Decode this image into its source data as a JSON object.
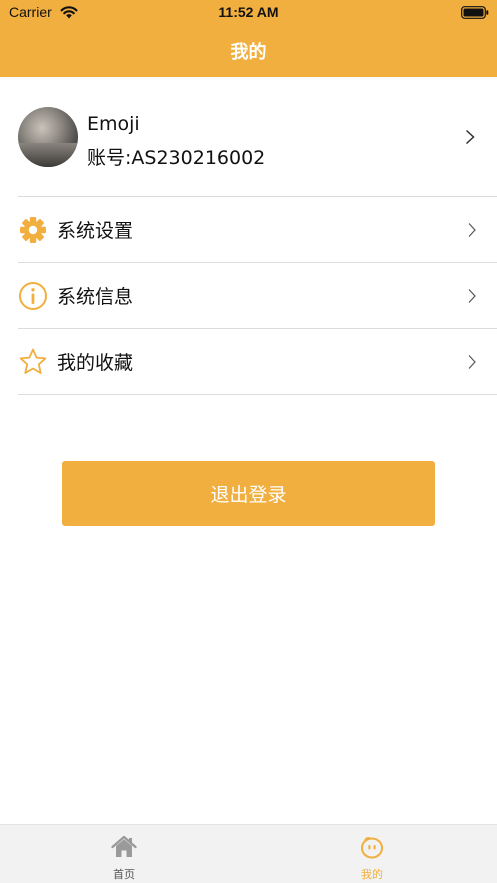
{
  "status_bar": {
    "carrier": "Carrier",
    "time": "11:52 AM"
  },
  "nav": {
    "title": "我的"
  },
  "profile": {
    "name": "Emoji",
    "account": "账号:AS230216002"
  },
  "menu": [
    {
      "label": "系统设置",
      "icon": "gear-icon"
    },
    {
      "label": "系统信息",
      "icon": "info-icon"
    },
    {
      "label": "我的收藏",
      "icon": "star-icon"
    }
  ],
  "logout": {
    "label": "退出登录"
  },
  "tabbar": {
    "tabs": [
      {
        "label": "首页",
        "icon": "home-icon",
        "selected": false
      },
      {
        "label": "我的",
        "icon": "face-icon",
        "selected": true
      }
    ]
  },
  "colors": {
    "accent": "#F1AF3F",
    "inactive": "#8e8e8e"
  }
}
